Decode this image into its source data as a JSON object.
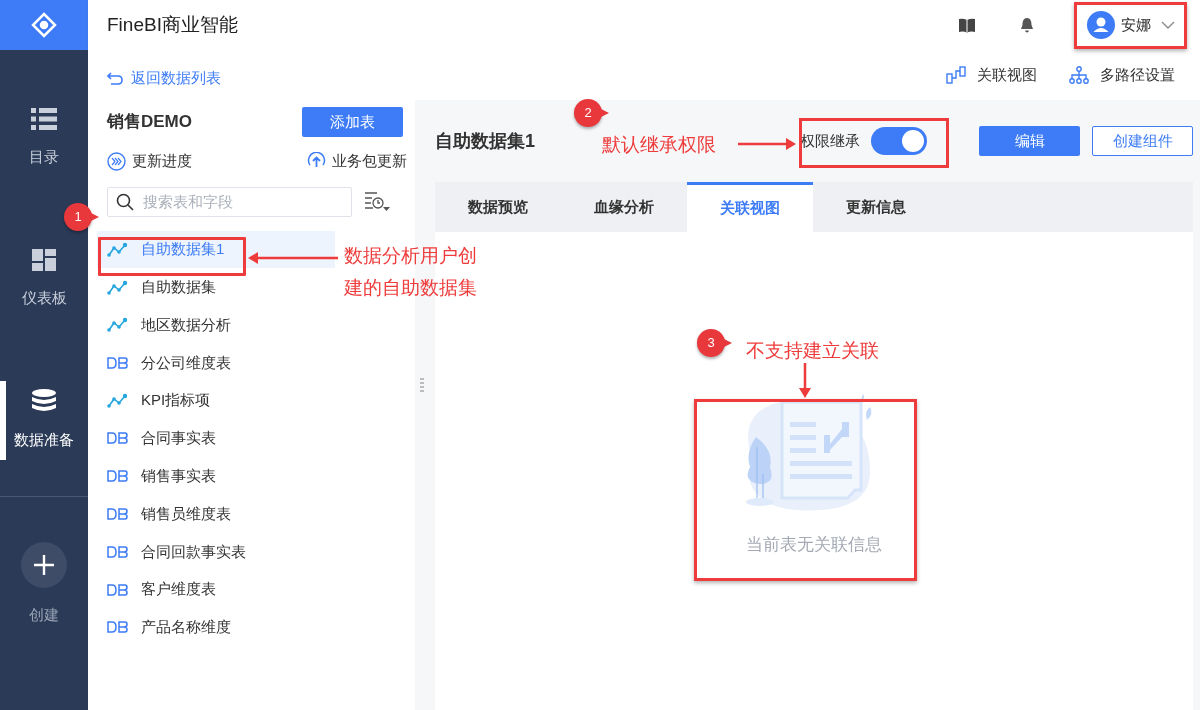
{
  "nav": {
    "items": [
      {
        "label": "目录",
        "kind": "catalog",
        "selected": false
      },
      {
        "label": "仪表板",
        "kind": "dashboard",
        "selected": false
      },
      {
        "label": "数据准备",
        "kind": "data",
        "selected": true
      }
    ],
    "create": {
      "label": "创建"
    }
  },
  "header": {
    "title": "FineBI商业智能",
    "user": "安娜"
  },
  "left_panel": {
    "back_link": "返回数据列表",
    "package": "销售DEMO",
    "add_button": "添加表",
    "update_progress": "更新进度",
    "package_update": "业务包更新",
    "search": {
      "placeholder": "搜索表和字段"
    },
    "tables": [
      {
        "name": "自助数据集1",
        "kind": "analysis",
        "selected": true
      },
      {
        "name": "自助数据集",
        "kind": "analysis",
        "selected": false
      },
      {
        "name": "地区数据分析",
        "kind": "analysis",
        "selected": false
      },
      {
        "name": "分公司维度表",
        "kind": "db",
        "selected": false
      },
      {
        "name": "KPI指标项",
        "kind": "analysis",
        "selected": false
      },
      {
        "name": "合同事实表",
        "kind": "db",
        "selected": false
      },
      {
        "name": "销售事实表",
        "kind": "db",
        "selected": false
      },
      {
        "name": "销售员维度表",
        "kind": "db",
        "selected": false
      },
      {
        "name": "合同回款事实表",
        "kind": "db",
        "selected": false
      },
      {
        "name": "客户维度表",
        "kind": "db",
        "selected": false
      },
      {
        "name": "产品名称维度",
        "kind": "db",
        "selected": false
      }
    ]
  },
  "toolbar": [
    {
      "label": "关联视图",
      "kind": "relation"
    },
    {
      "label": "多路径设置",
      "kind": "paths"
    }
  ],
  "dataset": {
    "title": "自助数据集1",
    "permission": {
      "label": "权限继承",
      "on": true
    },
    "edit_button": "编辑",
    "create_button": "创建组件",
    "tabs": [
      {
        "label": "数据预览",
        "selected": false
      },
      {
        "label": "血缘分析",
        "selected": false
      },
      {
        "label": "关联视图",
        "selected": true
      },
      {
        "label": "更新信息",
        "selected": false
      }
    ],
    "empty_message": "当前表无关联信息"
  },
  "annotations": [
    {
      "number": "1",
      "text": "数据分析用户创建的自助数据集"
    },
    {
      "number": "2",
      "text": "默认继承权限"
    },
    {
      "number": "3",
      "text": "不支持建立关联"
    }
  ]
}
